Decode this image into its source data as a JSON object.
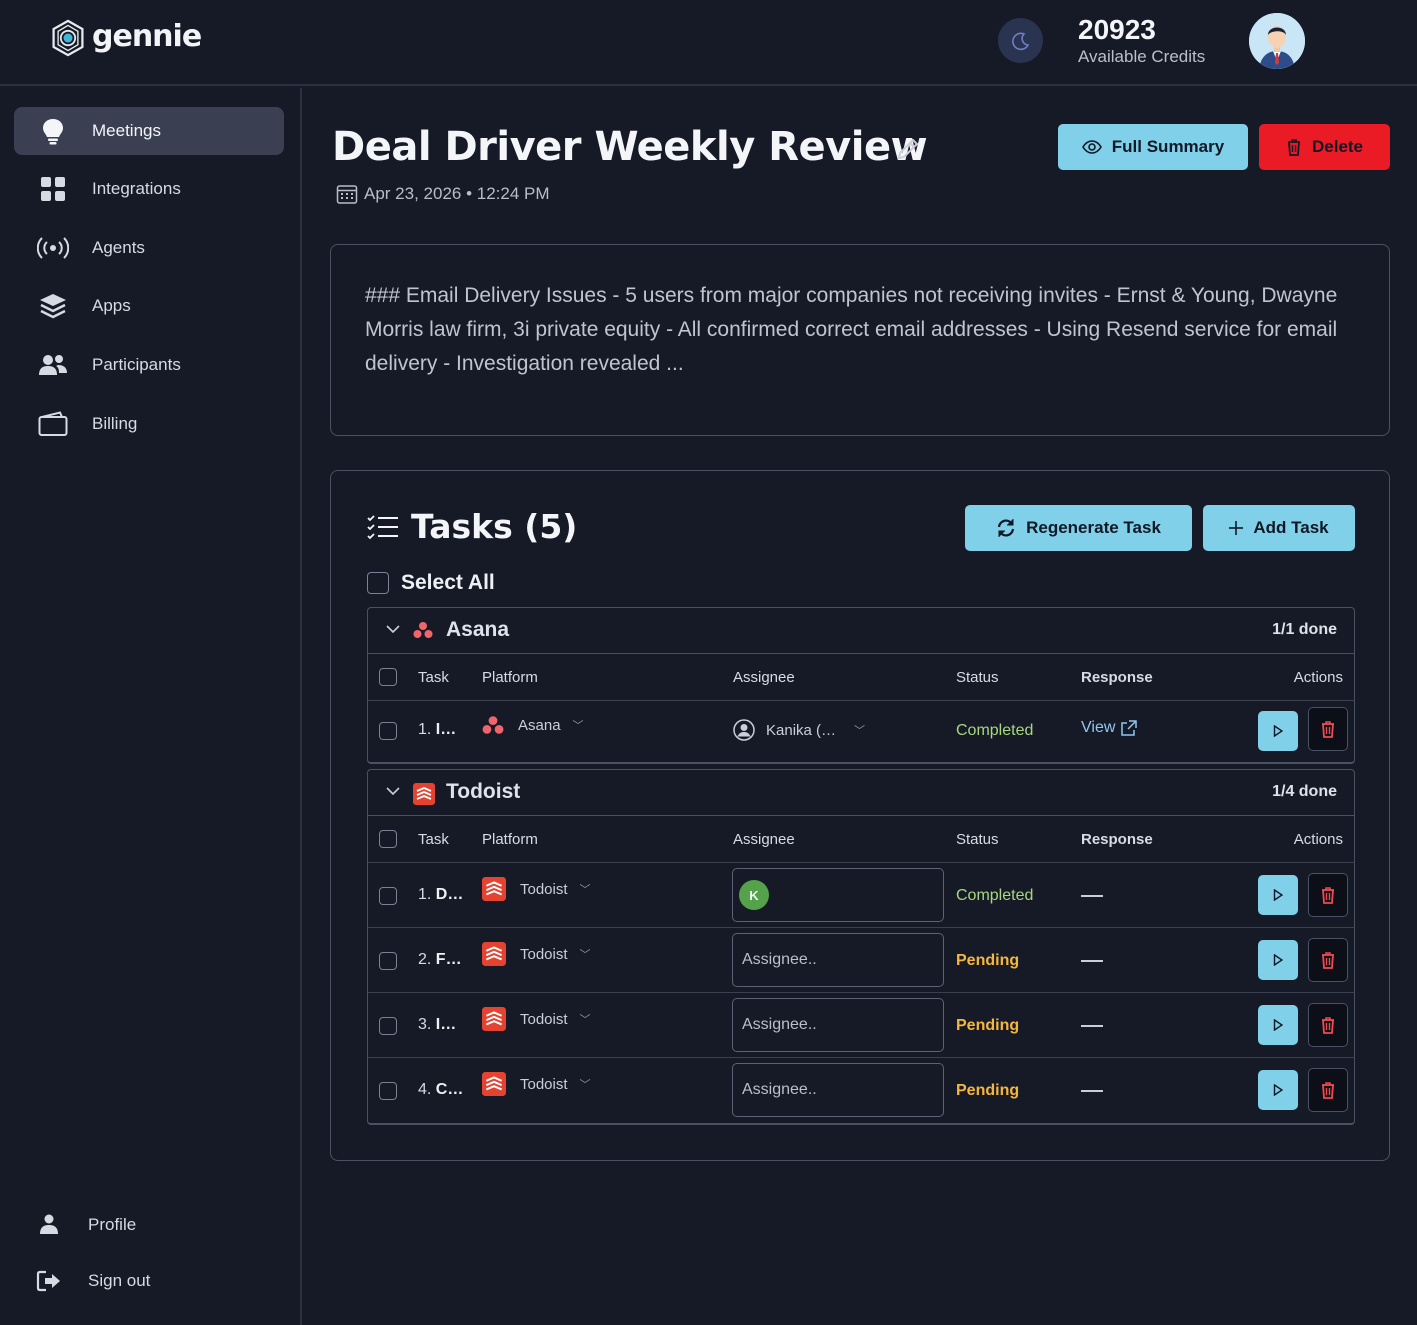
{
  "app": {
    "name": "gennie",
    "credits_value": "20923",
    "credits_label": "Available Credits"
  },
  "sidebar": {
    "items": [
      {
        "label": "Meetings",
        "icon": "lightbulb-icon",
        "active": true
      },
      {
        "label": "Integrations",
        "icon": "grid-icon"
      },
      {
        "label": "Agents",
        "icon": "broadcast-icon"
      },
      {
        "label": "Apps",
        "icon": "layers-icon"
      },
      {
        "label": "Participants",
        "icon": "users-icon"
      },
      {
        "label": "Billing",
        "icon": "wallet-icon"
      }
    ],
    "bottom": [
      {
        "label": "Profile",
        "icon": "user-icon"
      },
      {
        "label": "Sign out",
        "icon": "sign-out-icon"
      }
    ]
  },
  "meeting": {
    "title": "Deal Driver Weekly Review",
    "datetime": "Apr 23, 2026 • 12:24 PM",
    "full_summary_label": "Full Summary",
    "delete_label": "Delete",
    "summary": "### Email Delivery Issues - 5 users from major companies not receiving invites - Ernst & Young, Dwayne Morris law firm, 3i private equity - All confirmed correct email addresses - Using Resend service for email delivery - Investigation revealed ..."
  },
  "tasks": {
    "title": "Tasks (5)",
    "regenerate_label": "Regenerate Task",
    "add_label": "Add Task",
    "select_all_label": "Select All",
    "columns": {
      "task": "Task",
      "platform": "Platform",
      "assignee": "Assignee",
      "status": "Status",
      "response": "Response",
      "actions": "Actions"
    },
    "groups": [
      {
        "name": "Asana",
        "done": "1/1 done",
        "rows": [
          {
            "num": "1.",
            "name": "I…",
            "platform": "Asana",
            "assignee": "Kanika (…",
            "status": "Completed",
            "response": "View"
          }
        ]
      },
      {
        "name": "Todoist",
        "done": "1/4 done",
        "rows": [
          {
            "num": "1.",
            "name": "D…",
            "platform": "Todoist",
            "assignee_initial": "K",
            "status": "Completed",
            "response": "—"
          },
          {
            "num": "2.",
            "name": "F…",
            "platform": "Todoist",
            "assignee_placeholder": "Assignee..",
            "status": "Pending",
            "response": "—"
          },
          {
            "num": "3.",
            "name": "I…",
            "platform": "Todoist",
            "assignee_placeholder": "Assignee..",
            "status": "Pending",
            "response": "—"
          },
          {
            "num": "4.",
            "name": "C…",
            "platform": "Todoist",
            "assignee_placeholder": "Assignee..",
            "status": "Pending",
            "response": "—"
          }
        ]
      }
    ]
  },
  "colors": {
    "background": "#161a27",
    "accent": "#7fd0e8",
    "danger": "#ea1b24",
    "completed": "#a6d87e",
    "pending": "#f6b63c"
  }
}
